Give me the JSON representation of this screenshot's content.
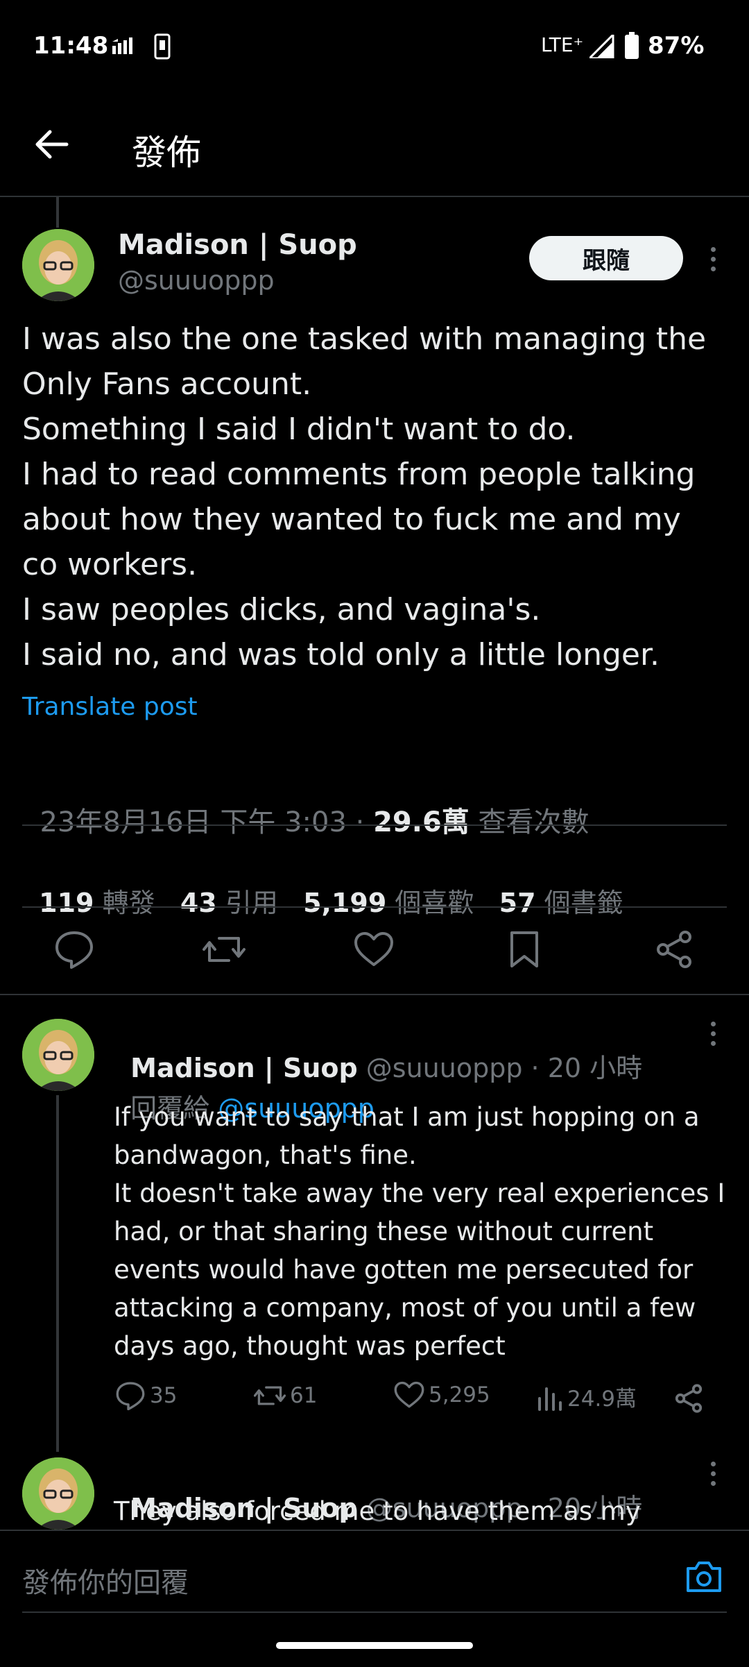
{
  "status_bar": {
    "time": "11:48",
    "network": "LTE⁺",
    "battery": "87%"
  },
  "header": {
    "title": "發佈"
  },
  "main_post": {
    "display_name": "Madison | Suop",
    "handle": "@suuuoppp",
    "follow_label": "跟隨",
    "text": "I was also the one tasked with managing the\nOnly Fans account.\nSomething I said I didn't want to do.\nI had to read comments from people talking\nabout how they wanted to fuck me and my\nco workers.\nI saw peoples dicks, and vagina's.\nI said no, and was told only a little longer.",
    "translate_label": "Translate post",
    "timestamp": "23年8月16日 下午 3:03 · ",
    "views_count": "29.6萬",
    "views_label": " 查看次數",
    "stats": {
      "reposts_count": "119",
      "reposts_label": "轉發",
      "quotes_count": "43",
      "quotes_label": "引用",
      "likes_count": "5,199",
      "likes_label": "個喜歡",
      "bookmarks_count": "57",
      "bookmarks_label": "個書籤"
    }
  },
  "replies": [
    {
      "display_name": "Madison | Suop",
      "handle_time": "@suuuoppp · 20 小時",
      "reply_to_prefix": "回覆給 ",
      "reply_to_handle": "@suuuoppp",
      "text": "If you want to say that I am just hopping on a\nbandwagon, that's fine.\nIt doesn't take away the very real experiences I\nhad, or that sharing these without current\nevents would have gotten me persecuted for\nattacking a company, most of you until a few\ndays ago, thought was perfect",
      "replies_count": "35",
      "reposts_count": "61",
      "likes_count": "5,295",
      "views_count": "24.9萬"
    },
    {
      "display_name": "Madison | Suop",
      "handle_time": "@suuuoppp · 20 小時",
      "text": "They also forced me to have them as my"
    }
  ],
  "composer": {
    "placeholder": "發佈你的回覆"
  },
  "colors": {
    "accent": "#1d9bf0",
    "background": "#000000",
    "muted": "#71767b"
  }
}
